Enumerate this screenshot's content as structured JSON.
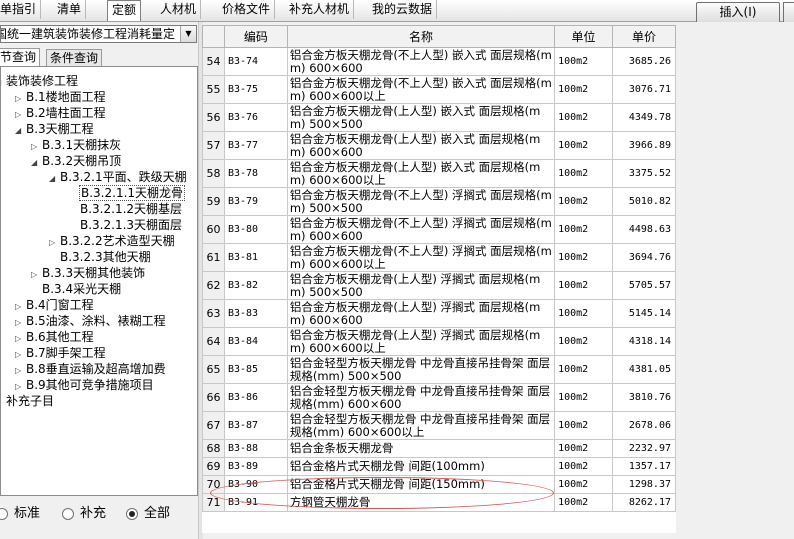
{
  "top_tabs": [
    {
      "label": "单指引",
      "active": false
    },
    {
      "label": "清单",
      "active": false
    },
    {
      "label": "定额",
      "active": true
    },
    {
      "label": "人材机",
      "active": false
    },
    {
      "label": "价格文件",
      "active": false
    },
    {
      "label": "补充人材机",
      "active": false
    },
    {
      "label": "我的云数据",
      "active": false
    }
  ],
  "insert_button": "插入(I)",
  "library_select": "国统一建筑装饰装修工程消耗量定",
  "sub_tabs": [
    {
      "label": "节查询",
      "active": true
    },
    {
      "label": "条件查询",
      "active": false
    }
  ],
  "tree": [
    {
      "label": "装饰装修工程",
      "toggle": "◢",
      "level": 0
    },
    {
      "label": "B.1楼地面工程",
      "toggle": "▷",
      "level": 1
    },
    {
      "label": "B.2墙柱面工程",
      "toggle": "▷",
      "level": 1
    },
    {
      "label": "B.3天棚工程",
      "toggle": "◢",
      "level": 1
    },
    {
      "label": "B.3.1天棚抹灰",
      "toggle": "▷",
      "level": 2
    },
    {
      "label": "B.3.2天棚吊顶",
      "toggle": "◢",
      "level": 2
    },
    {
      "label": "B.3.2.1平面、跌级天棚",
      "toggle": "◢",
      "level": 3
    },
    {
      "label": "B.3.2.1.1天棚龙骨",
      "toggle": "",
      "level": 4,
      "selected": true
    },
    {
      "label": "B.3.2.1.2天棚基层",
      "toggle": "",
      "level": 4
    },
    {
      "label": "B.3.2.1.3天棚面层",
      "toggle": "",
      "level": 4
    },
    {
      "label": "B.3.2.2艺术造型天棚",
      "toggle": "▷",
      "level": 3
    },
    {
      "label": "B.3.2.3其他天棚",
      "toggle": "",
      "level": 3
    },
    {
      "label": "B.3.3天棚其他装饰",
      "toggle": "▷",
      "level": 2
    },
    {
      "label": "B.3.4采光天棚",
      "toggle": "",
      "level": 2
    },
    {
      "label": "B.4门窗工程",
      "toggle": "▷",
      "level": 1
    },
    {
      "label": "B.5油漆、涂料、裱糊工程",
      "toggle": "▷",
      "level": 1
    },
    {
      "label": "B.6其他工程",
      "toggle": "▷",
      "level": 1
    },
    {
      "label": "B.7脚手架工程",
      "toggle": "▷",
      "level": 1
    },
    {
      "label": "B.8垂直运输及超高增加费",
      "toggle": "▷",
      "level": 1
    },
    {
      "label": "B.9其他可竞争措施项目",
      "toggle": "▷",
      "level": 1
    },
    {
      "label": "补充子目",
      "toggle": "▷",
      "level": 0
    }
  ],
  "radio_options": [
    {
      "label": "标准",
      "checked": false
    },
    {
      "label": "补充",
      "checked": false
    },
    {
      "label": "全部",
      "checked": true
    }
  ],
  "columns": {
    "code": "编码",
    "name": "名称",
    "unit": "单位",
    "price": "单价"
  },
  "rows": [
    {
      "idx": "54",
      "code": "B3-74",
      "name": "铝合金方板天棚龙骨(不上人型) 嵌入式 面层规格(mm) 600×600",
      "unit": "100m2",
      "price": "3685.26"
    },
    {
      "idx": "55",
      "code": "B3-75",
      "name": "铝合金方板天棚龙骨(不上人型) 嵌入式 面层规格(mm) 600×600以上",
      "unit": "100m2",
      "price": "3076.71"
    },
    {
      "idx": "56",
      "code": "B3-76",
      "name": "铝合金方板天棚龙骨(上人型) 嵌入式 面层规格(mm) 500×500",
      "unit": "100m2",
      "price": "4349.78"
    },
    {
      "idx": "57",
      "code": "B3-77",
      "name": "铝合金方板天棚龙骨(上人型) 嵌入式 面层规格(mm) 600×600",
      "unit": "100m2",
      "price": "3966.89"
    },
    {
      "idx": "58",
      "code": "B3-78",
      "name": "铝合金方板天棚龙骨(上人型) 嵌入式 面层规格(mm) 600×600以上",
      "unit": "100m2",
      "price": "3375.52"
    },
    {
      "idx": "59",
      "code": "B3-79",
      "name": "铝合金方板天棚龙骨(不上人型) 浮搁式 面层规格(mm) 500×500",
      "unit": "100m2",
      "price": "5010.82"
    },
    {
      "idx": "60",
      "code": "B3-80",
      "name": "铝合金方板天棚龙骨(不上人型) 浮搁式 面层规格(mm) 600×600",
      "unit": "100m2",
      "price": "4498.63"
    },
    {
      "idx": "61",
      "code": "B3-81",
      "name": "铝合金方板天棚龙骨(不上人型) 浮搁式 面层规格(mm) 600×600以上",
      "unit": "100m2",
      "price": "3694.76"
    },
    {
      "idx": "62",
      "code": "B3-82",
      "name": "铝合金方板天棚龙骨(上人型) 浮搁式 面层规格(mm) 500×500",
      "unit": "100m2",
      "price": "5705.57"
    },
    {
      "idx": "63",
      "code": "B3-83",
      "name": "铝合金方板天棚龙骨(上人型) 浮搁式 面层规格(mm) 600×600",
      "unit": "100m2",
      "price": "5145.14"
    },
    {
      "idx": "64",
      "code": "B3-84",
      "name": "铝合金方板天棚龙骨(上人型) 浮搁式 面层规格(mm) 600×600以上",
      "unit": "100m2",
      "price": "4318.14"
    },
    {
      "idx": "65",
      "code": "B3-85",
      "name": "铝合金轻型方板天棚龙骨 中龙骨直接吊挂骨架 面层规格(mm) 500×500",
      "unit": "100m2",
      "price": "4381.05"
    },
    {
      "idx": "66",
      "code": "B3-86",
      "name": "铝合金轻型方板天棚龙骨 中龙骨直接吊挂骨架 面层规格(mm) 600×600",
      "unit": "100m2",
      "price": "3810.76"
    },
    {
      "idx": "67",
      "code": "B3-87",
      "name": "铝合金轻型方板天棚龙骨 中龙骨直接吊挂骨架 面层规格(mm) 600×600以上",
      "unit": "100m2",
      "price": "2678.06"
    },
    {
      "idx": "68",
      "code": "B3-88",
      "name": "铝合金条板天棚龙骨",
      "unit": "100m2",
      "price": "2232.97"
    },
    {
      "idx": "69",
      "code": "B3-89",
      "name": "铝合金格片式天棚龙骨 间距(100mm)",
      "unit": "100m2",
      "price": "1357.17"
    },
    {
      "idx": "70",
      "code": "B3-90",
      "name": "铝合金格片式天棚龙骨 间距(150mm)",
      "unit": "100m2",
      "price": "1298.37"
    },
    {
      "idx": "71",
      "code": "B3-91",
      "name": "方钢管天棚龙骨",
      "unit": "100m2",
      "price": "8262.17"
    }
  ]
}
